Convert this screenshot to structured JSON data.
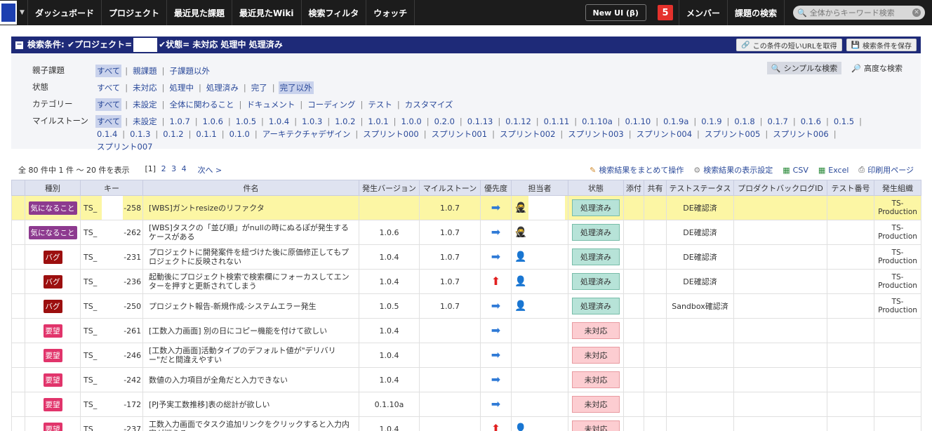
{
  "nav": {
    "items": [
      "ダッシュボード",
      "プロジェクト",
      "最近見た課題",
      "最近見たWiki",
      "検索フィルタ",
      "ウォッチ"
    ],
    "newui": "New UI (β)",
    "badge": "5",
    "member": "メンバー",
    "issue_search": "課題の検索",
    "search_placeholder": "全体からキーワード検索"
  },
  "filterbar": {
    "toggle": "−",
    "label_prefix": "検索条件: ✔プロジェクト=",
    "label_suffix": "✔状態= 未対応 処理中 処理済み",
    "short_url_btn": "この条件の短いURLを取得",
    "save_btn": "検索条件を保存"
  },
  "search_mode": {
    "simple": "シンプルな検索",
    "advanced": "高度な検索"
  },
  "filters": [
    {
      "label": "親子課題",
      "options": [
        {
          "t": "すべて",
          "sel": true
        },
        {
          "t": "親課題"
        },
        {
          "t": "子課題以外"
        }
      ]
    },
    {
      "label": "状態",
      "options": [
        {
          "t": "すべて"
        },
        {
          "t": "未対応"
        },
        {
          "t": "処理中"
        },
        {
          "t": "処理済み"
        },
        {
          "t": "完了"
        },
        {
          "t": "完了以外",
          "sel": true
        }
      ]
    },
    {
      "label": "カテゴリー",
      "options": [
        {
          "t": "すべて",
          "sel": true
        },
        {
          "t": "未設定"
        },
        {
          "t": "全体に関わること"
        },
        {
          "t": "ドキュメント"
        },
        {
          "t": "コーディング"
        },
        {
          "t": "テスト"
        },
        {
          "t": "カスタマイズ"
        }
      ]
    },
    {
      "label": "マイルストーン",
      "options": [
        {
          "t": "すべて",
          "sel": true
        },
        {
          "t": "未設定"
        },
        {
          "t": "1.0.7"
        },
        {
          "t": "1.0.6"
        },
        {
          "t": "1.0.5"
        },
        {
          "t": "1.0.4"
        },
        {
          "t": "1.0.3"
        },
        {
          "t": "1.0.2"
        },
        {
          "t": "1.0.1"
        },
        {
          "t": "1.0.0"
        },
        {
          "t": "0.2.0"
        },
        {
          "t": "0.1.13"
        },
        {
          "t": "0.1.12"
        },
        {
          "t": "0.1.11"
        },
        {
          "t": "0.1.10a"
        },
        {
          "t": "0.1.10"
        },
        {
          "t": "0.1.9a"
        },
        {
          "t": "0.1.9"
        },
        {
          "t": "0.1.8"
        },
        {
          "t": "0.1.7"
        },
        {
          "t": "0.1.6"
        },
        {
          "t": "0.1.5"
        },
        {
          "t": "0.1.4"
        },
        {
          "t": "0.1.3"
        },
        {
          "t": "0.1.2"
        },
        {
          "t": "0.1.1"
        },
        {
          "t": "0.1.0"
        },
        {
          "t": "アーキテクチャデザイン"
        },
        {
          "t": "スプリント000"
        },
        {
          "t": "スプリント001"
        },
        {
          "t": "スプリント002"
        },
        {
          "t": "スプリント003"
        },
        {
          "t": "スプリント004"
        },
        {
          "t": "スプリント005"
        },
        {
          "t": "スプリント006"
        },
        {
          "t": "スプリント007"
        }
      ]
    }
  ],
  "summary": {
    "count_text": "全 80 件中 1 件 〜 20 件を表示",
    "current_page": "[1]",
    "pages": [
      "2",
      "3",
      "4"
    ],
    "next": "次へ >"
  },
  "actions": [
    "検索結果をまとめて操作",
    "検索結果の表示設定",
    "CSV",
    "Excel",
    "印刷用ページ"
  ],
  "columns": [
    "",
    "種別",
    "キー",
    "件名",
    "発生バージョン",
    "マイルストーン",
    "優先度",
    "担当者",
    "状態",
    "添付",
    "共有",
    "テストステータス",
    "プロダクトバックログID",
    "テスト番号",
    "発生組織"
  ],
  "rows": [
    {
      "hl": true,
      "tracker": "気になること",
      "tcls": "t-kini",
      "key_pre": "TS_",
      "key_num": "-258",
      "subject": "[WBS]ガントresizeのリファクタ",
      "version": "",
      "milestone": "1.0.7",
      "priority": "normal",
      "assignee": "ninja",
      "status": "処理済み",
      "scls": "st-done",
      "test": "DE確認済",
      "org": "TS-Production"
    },
    {
      "hl": false,
      "tracker": "気になること",
      "tcls": "t-kini",
      "key_pre": "TS_",
      "key_num": "-262",
      "subject": "[WBS]タスクの「並び順」がnullの時にぬるぽが発生するケースがある",
      "version": "1.0.6",
      "milestone": "1.0.7",
      "priority": "normal",
      "assignee": "ninja",
      "status": "処理済み",
      "scls": "st-done",
      "test": "DE確認済",
      "org": "TS-Production"
    },
    {
      "hl": false,
      "tracker": "バグ",
      "tcls": "t-bug",
      "key_pre": "TS_",
      "key_num": "-231",
      "subject": "プロジェクトに開発案件を紐づけた後に原価修正してもプロジェクトに反映されない",
      "version": "1.0.4",
      "milestone": "1.0.7",
      "priority": "normal",
      "assignee": "man",
      "status": "処理済み",
      "scls": "st-done",
      "test": "DE確認済",
      "org": "TS-Production"
    },
    {
      "hl": false,
      "tracker": "バグ",
      "tcls": "t-bug",
      "key_pre": "TS_",
      "key_num": "-236",
      "subject": "起動後にプロジェクト検索で検索欄にフォーカスしてエンターを押すと更新されてしまう",
      "version": "1.0.4",
      "milestone": "1.0.7",
      "priority": "high",
      "assignee": "man",
      "status": "処理済み",
      "scls": "st-done",
      "test": "DE確認済",
      "org": "TS-Production"
    },
    {
      "hl": false,
      "tracker": "バグ",
      "tcls": "t-bug",
      "key_pre": "TS_",
      "key_num": "-250",
      "subject": "プロジェクト報告-新規作成-システムエラー発生",
      "version": "1.0.5",
      "milestone": "1.0.7",
      "priority": "normal",
      "assignee": "man",
      "status": "処理済み",
      "scls": "st-done",
      "test": "Sandbox確認済",
      "org": "TS-Production"
    },
    {
      "hl": false,
      "tracker": "要望",
      "tcls": "t-yobo",
      "key_pre": "TS_",
      "key_num": "-261",
      "subject": "[工数入力画面] 別の日にコピー機能を付けて欲しい",
      "version": "1.0.4",
      "milestone": "",
      "priority": "normal",
      "assignee": "",
      "status": "未対応",
      "scls": "st-new",
      "test": "",
      "org": ""
    },
    {
      "hl": false,
      "tracker": "要望",
      "tcls": "t-yobo",
      "key_pre": "TS_",
      "key_num": "-246",
      "subject": "[工数入力画面]活動タイプのデフォルト値が\"デリバリー\"だと間違えやすい",
      "version": "1.0.4",
      "milestone": "",
      "priority": "normal",
      "assignee": "",
      "status": "未対応",
      "scls": "st-new",
      "test": "",
      "org": ""
    },
    {
      "hl": false,
      "tracker": "要望",
      "tcls": "t-yobo",
      "key_pre": "TS_",
      "key_num": "-242",
      "subject": "数値の入力項目が全角だと入力できない",
      "version": "1.0.4",
      "milestone": "",
      "priority": "normal",
      "assignee": "",
      "status": "未対応",
      "scls": "st-new",
      "test": "",
      "org": ""
    },
    {
      "hl": false,
      "tracker": "要望",
      "tcls": "t-yobo",
      "key_pre": "TS_",
      "key_num": "-172",
      "subject": "[PJ予実工数推移]表の総計が欲しい",
      "version": "0.1.10a",
      "milestone": "",
      "priority": "normal",
      "assignee": "",
      "status": "未対応",
      "scls": "st-new",
      "test": "",
      "org": ""
    },
    {
      "hl": false,
      "tracker": "要望",
      "tcls": "t-yobo",
      "key_pre": "TS_",
      "key_num": "-237",
      "subject": "工数入力画面でタスク追加リンクをクリックすると入力内容が消える",
      "version": "1.0.4",
      "milestone": "",
      "priority": "high",
      "assignee": "man",
      "status": "未対応",
      "scls": "st-new",
      "test": "",
      "org": ""
    }
  ]
}
